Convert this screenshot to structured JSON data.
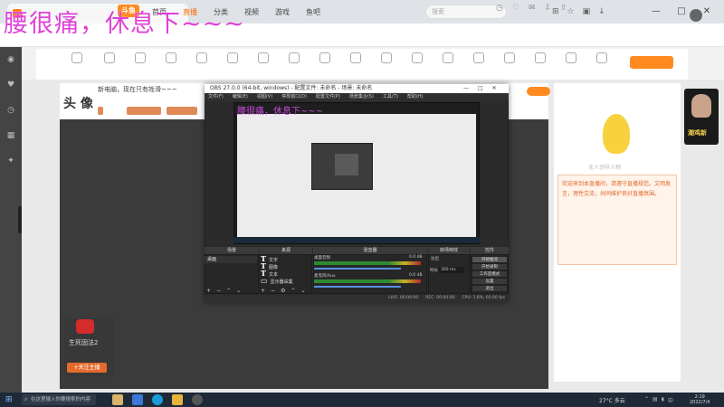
{
  "overlay_title": "腰很痛，休息下~~~",
  "browser": {
    "window_controls": [
      "—",
      "□",
      "✕"
    ]
  },
  "site": {
    "logo": "斗鱼",
    "nav": [
      "首页",
      "直播",
      "分类",
      "视频",
      "游戏",
      "鱼吧"
    ],
    "active_nav": "直播",
    "search_placeholder": "搜索"
  },
  "room": {
    "title": "头 像",
    "topline": "新电脑，现在只有姓滑~~~",
    "follow_label": ""
  },
  "streamer": {
    "name": "生死固法2",
    "follow_label": "+关注主播"
  },
  "notice": {
    "text": "欢迎来到本直播间，请遵守直播规范。文明发言，理性交流，共同维护良好直播氛围。"
  },
  "ad": {
    "text": "潮鸡新"
  },
  "mascot": {
    "caption": "无人领导人物"
  },
  "obs": {
    "title": "OBS 27.0.0 (64-bit, windows) - 配置文件: 未命名 - 场景: 未命名",
    "menu": [
      "文件(F)",
      "编辑(E)",
      "视图(V)",
      "停靠窗口(D)",
      "配置文件(P)",
      "场景集合(S)",
      "工具(T)",
      "帮助(H)"
    ],
    "docks": {
      "scenes": "场景",
      "sources": "来源",
      "mixer": "混音器",
      "transitions": "转场特效",
      "controls": "控件"
    },
    "scene_item": "桌面",
    "sources": [
      "文字",
      "图像",
      "文本",
      "显示器采集"
    ],
    "mixer": [
      {
        "label": "桌面音频",
        "value": "0.0 dB"
      },
      {
        "label": "麦克风/Aux",
        "value": "0.0 dB"
      }
    ],
    "transition_name": "淡出",
    "transition_duration_label": "时长",
    "transition_duration": "300 ms",
    "controls": [
      "开始推流",
      "开始录制",
      "工作室模式",
      "设置",
      "退出"
    ],
    "status": [
      "LIVE: 00:00:00",
      "REC: 00:00:00",
      "CPU: 1.8%, 60.00 fps"
    ]
  },
  "taskbar": {
    "search_placeholder": "在这里输入你要搜索的内容",
    "weather": "27°C  多云",
    "time": "2:19",
    "date": "2022/7/4"
  },
  "colors": {
    "accent": "#ff6a00",
    "overlay": "#e040d8",
    "obs_bg": "#2b2b2b"
  }
}
